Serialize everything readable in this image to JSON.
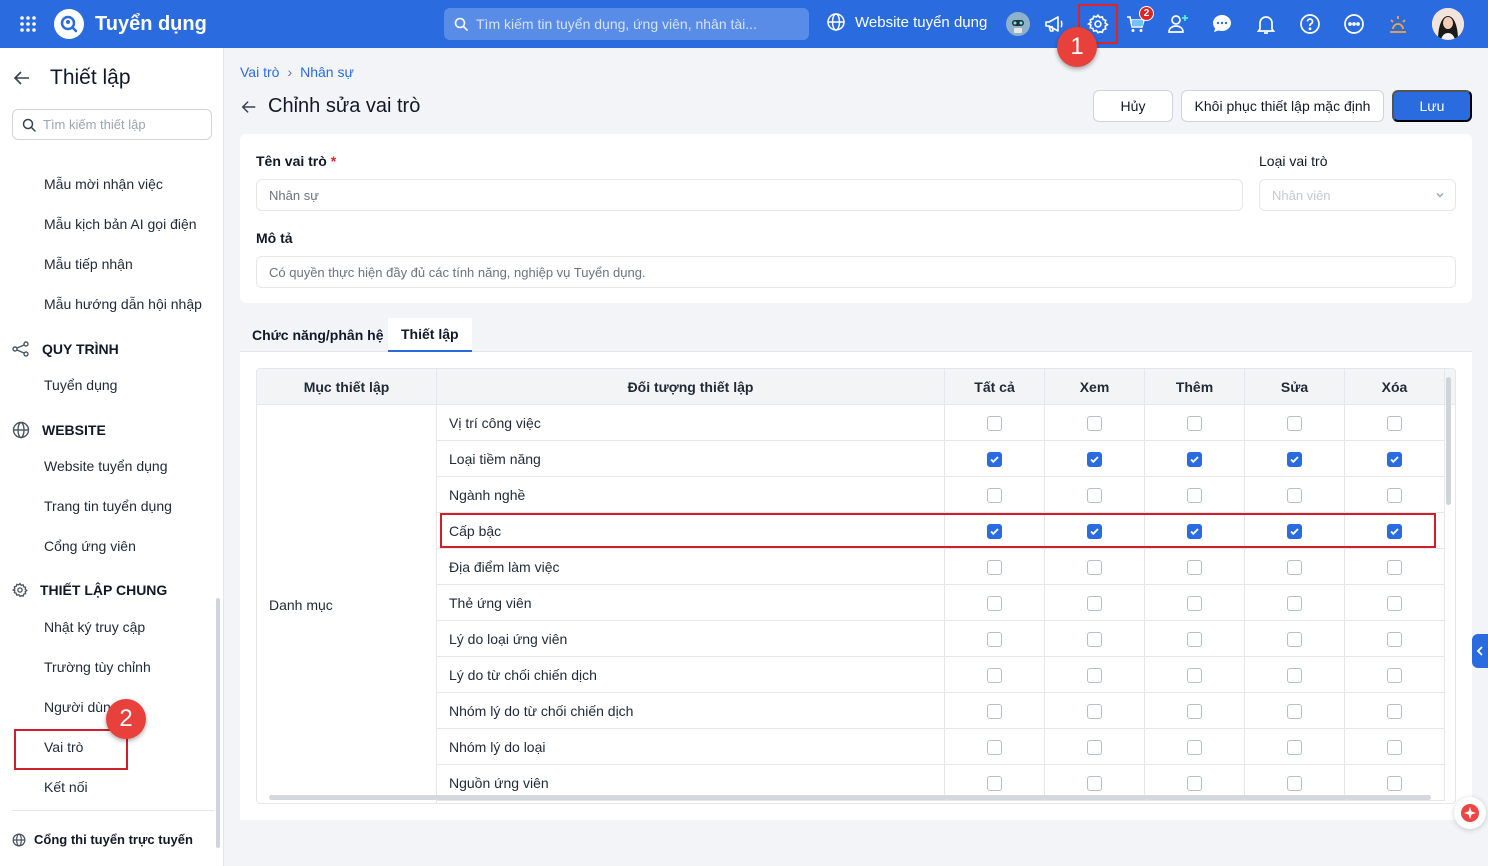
{
  "topbar": {
    "app_title": "Tuyển dụng",
    "search_placeholder": "Tìm kiếm tin tuyển dụng, ứng viên, nhân tài...",
    "site_link": "Website tuyển dụng",
    "cart_badge": "2",
    "callout_1": "1",
    "brand_color": "#2a6ce0",
    "icons": [
      "apps-grid-icon",
      "app-logo-icon",
      "globe-icon",
      "robot-avatar-icon",
      "megaphone-icon",
      "settings-gear-icon",
      "cart-icon",
      "add-user-icon",
      "chat-icon",
      "bell-icon",
      "help-icon",
      "more-icon",
      "sun-icon",
      "user-avatar"
    ]
  },
  "sidebar": {
    "title": "Thiết lập",
    "search_placeholder": "Tìm kiếm thiết lập",
    "items_top": [
      "Mẫu mời nhận việc",
      "Mẫu kịch bản AI gọi điện",
      "Mẫu tiếp nhận",
      "Mẫu hướng dẫn hội nhập"
    ],
    "group_quy_trinh": "QUY TRÌNH",
    "items_quy_trinh": [
      "Tuyển dụng"
    ],
    "group_website": "WEBSITE",
    "items_website": [
      "Website tuyển dụng",
      "Trang tin tuyển dụng",
      "Cổng ứng viên"
    ],
    "group_thiet_lap_chung": "THIẾT LẬP CHUNG",
    "items_thiet_lap_chung": [
      "Nhật ký truy cập",
      "Trường tùy chỉnh",
      "Người dùng",
      "Vai trò",
      "Kết nối"
    ],
    "bottom_link": "Cổng thi tuyển trực tuyến",
    "callout_2": "2"
  },
  "breadcrumb": [
    "Vai trò",
    "Nhân sự"
  ],
  "page": {
    "title": "Chỉnh sửa vai trò",
    "btn_cancel": "Hủy",
    "btn_restore": "Khôi phục thiết lập mặc định",
    "btn_save": "Lưu"
  },
  "form": {
    "role_name_label": "Tên vai trò",
    "required_mark": "*",
    "role_name_value": "Nhân sự",
    "role_type_label": "Loại vai trò",
    "role_type_value": "Nhân viên",
    "description_label": "Mô tả",
    "description_value": "Có quyền thực hiện đầy đủ các tính năng, nghiệp vụ Tuyển dụng."
  },
  "tabs": [
    "Chức năng/phân hệ",
    "Thiết lập"
  ],
  "table": {
    "headers": [
      "Mục thiết lập",
      "Đối tượng thiết lập",
      "Tất cả",
      "Xem",
      "Thêm",
      "Sửa",
      "Xóa"
    ],
    "group": "Danh mục",
    "rows": [
      {
        "name": "Vị trí công việc",
        "checks": [
          false,
          false,
          false,
          false,
          false
        ]
      },
      {
        "name": "Loại tiềm năng",
        "checks": [
          true,
          true,
          true,
          true,
          true
        ]
      },
      {
        "name": "Ngành nghề",
        "checks": [
          false,
          false,
          false,
          false,
          false
        ]
      },
      {
        "name": "Cấp bậc",
        "checks": [
          true,
          true,
          true,
          true,
          true
        ]
      },
      {
        "name": "Địa điểm làm việc",
        "checks": [
          false,
          false,
          false,
          false,
          false
        ]
      },
      {
        "name": "Thẻ ứng viên",
        "checks": [
          false,
          false,
          false,
          false,
          false
        ]
      },
      {
        "name": "Lý do loại ứng viên",
        "checks": [
          false,
          false,
          false,
          false,
          false
        ]
      },
      {
        "name": "Lý do từ chối chiến dịch",
        "checks": [
          false,
          false,
          false,
          false,
          false
        ]
      },
      {
        "name": "Nhóm lý do từ chối chiến dịch",
        "checks": [
          false,
          false,
          false,
          false,
          false
        ]
      },
      {
        "name": "Nhóm lý do loại",
        "checks": [
          false,
          false,
          false,
          false,
          false
        ]
      },
      {
        "name": "Nguồn ứng viên",
        "checks": [
          false,
          false,
          false,
          false,
          false
        ]
      }
    ]
  }
}
